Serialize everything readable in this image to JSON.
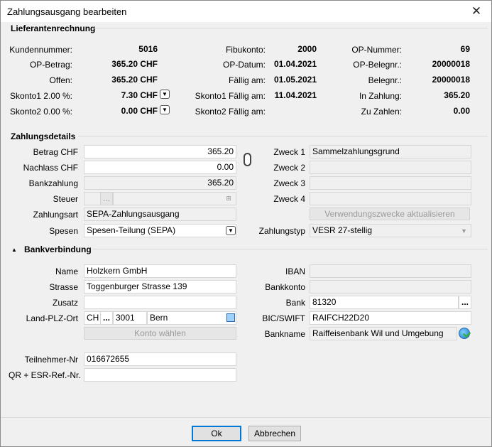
{
  "window": {
    "title": "Zahlungsausgang bearbeiten"
  },
  "lieferanten": {
    "section_title": "Lieferantenrechnung",
    "rows": [
      {
        "l1": "Kundennummer:",
        "v1": "5016",
        "l2": "Fibukonto:",
        "v2": "2000",
        "l3": "OP-Nummer:",
        "v3": "69"
      },
      {
        "l1": "OP-Betrag:",
        "v1": "365.20 CHF",
        "l2": "OP-Datum:",
        "v2": "01.04.2021",
        "l3": "OP-Belegnr.:",
        "v3": "20000018"
      },
      {
        "l1": "Offen:",
        "v1": "365.20 CHF",
        "l2": "Fällig am:",
        "v2": "01.05.2021",
        "l3": "Belegnr.:",
        "v3": "20000018"
      },
      {
        "l1": "Skonto1 2.00 %:",
        "v1": "7.30 CHF",
        "l2": "Skonto1 Fällig am:",
        "v2": "11.04.2021",
        "l3": "In Zahlung:",
        "v3": "365.20"
      },
      {
        "l1": "Skonto2 0.00 %:",
        "v1": "0.00 CHF",
        "l2": "Skonto2 Fällig am:",
        "v2": "",
        "l3": "Zu Zahlen:",
        "v3": "0.00"
      }
    ]
  },
  "zahlungsdetails": {
    "section_title": "Zahlungsdetails",
    "betrag_label": "Betrag CHF",
    "betrag_value": "365.20",
    "nachlass_label": "Nachlass CHF",
    "nachlass_value": "0.00",
    "bankzahlung_label": "Bankzahlung",
    "bankzahlung_value": "365.20",
    "steuer_label": "Steuer",
    "steuer_value": "",
    "zahlungsart_label": "Zahlungsart",
    "zahlungsart_value": "SEPA-Zahlungsausgang",
    "spesen_label": "Spesen",
    "spesen_value": "Spesen-Teilung (SEPA)",
    "zweck1_label": "Zweck 1",
    "zweck1_value": "Sammelzahlungsgrund",
    "zweck2_label": "Zweck 2",
    "zweck2_value": "",
    "zweck3_label": "Zweck 3",
    "zweck3_value": "",
    "zweck4_label": "Zweck 4",
    "zweck4_value": "",
    "aktualisieren_label": "Verwendungszwecke aktualisieren",
    "zahlungstyp_label": "Zahlungstyp",
    "zahlungstyp_value": "VESR 27-stellig"
  },
  "bank": {
    "section_title": "Bankverbindung",
    "name_label": "Name",
    "name_value": "Holzkern GmbH",
    "strasse_label": "Strasse",
    "strasse_value": "Toggenburger Strasse 139",
    "zusatz_label": "Zusatz",
    "zusatz_value": "",
    "land_label": "Land-PLZ-Ort",
    "land_value": "CH",
    "plz_value": "3001",
    "ort_value": "Bern",
    "konto_waehlen_label": "Konto wählen",
    "iban_label": "IBAN",
    "iban_value": "",
    "bankkonto_label": "Bankkonto",
    "bankkonto_value": "",
    "bank_label": "Bank",
    "bank_value": "81320",
    "bic_label": "BIC/SWIFT",
    "bic_value": "RAIFCH22D20",
    "bankname_label": "Bankname",
    "bankname_value": "Raiffeisenbank Wil und Umgebung",
    "teilnehmer_label": "Teilnehmer-Nr",
    "teilnehmer_value": "016672655",
    "qr_label": "QR + ESR-Ref.-Nr.",
    "qr_value": ""
  },
  "footer": {
    "ok_label": "Ok",
    "cancel_label": "Abbrechen"
  },
  "icons": {
    "close": "close-icon",
    "dropdown": "chevron-down-icon",
    "link": "chain-link-icon",
    "tree": "tree-icon",
    "globe": "globe-check-icon",
    "collapse": "triangle-up-icon"
  }
}
